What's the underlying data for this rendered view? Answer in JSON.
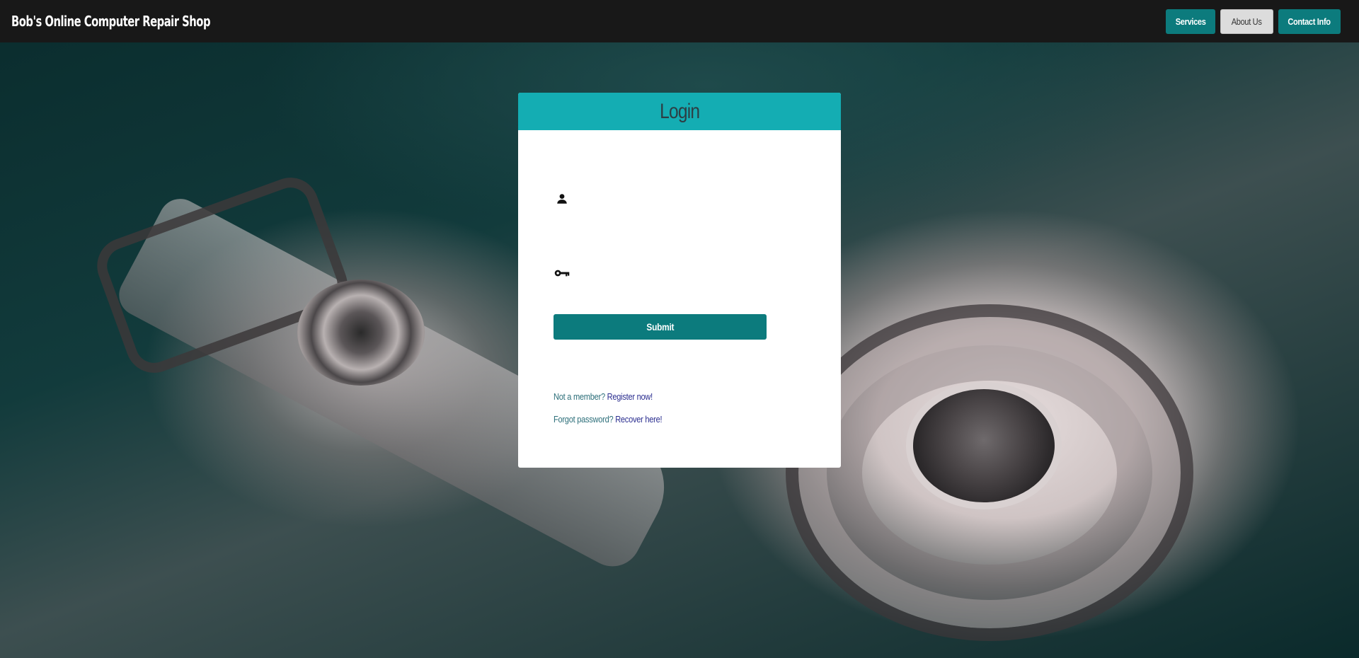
{
  "navbar": {
    "brand": "Bob's Online Computer Repair Shop",
    "buttons": {
      "services": "Services",
      "about": "About Us",
      "contact": "Contact Info"
    }
  },
  "login": {
    "title": "Login",
    "username_icon": "person-icon",
    "password_icon": "key-icon",
    "username_value": "",
    "password_value": "",
    "submit_label": "Submit",
    "register_prefix": "Not a member? ",
    "register_link": "Register now!",
    "recover_prefix": "Forgot password? ",
    "recover_link": "Recover here!"
  },
  "colors": {
    "navbar_bg": "#181818",
    "teal_button": "#0c7b7d",
    "card_header": "#14adb3",
    "link": "#2a2d8f"
  }
}
